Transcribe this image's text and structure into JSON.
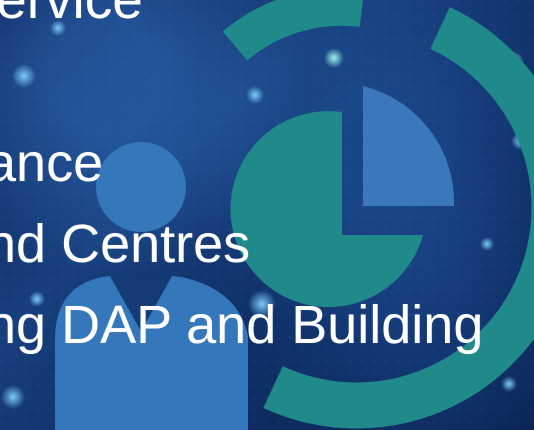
{
  "slide": {
    "lines": [
      "ivil Service",
      "ance",
      "nd Centres",
      "ng DAP and Building"
    ]
  },
  "icons": {
    "user": "person-icon",
    "analytics": "pie-chart-icon"
  },
  "colors": {
    "background": "#0d2d63",
    "text": "#ffffff",
    "person": "#3577bb",
    "ring": "#1f8a89",
    "chart_slice": "#3a77bd"
  }
}
